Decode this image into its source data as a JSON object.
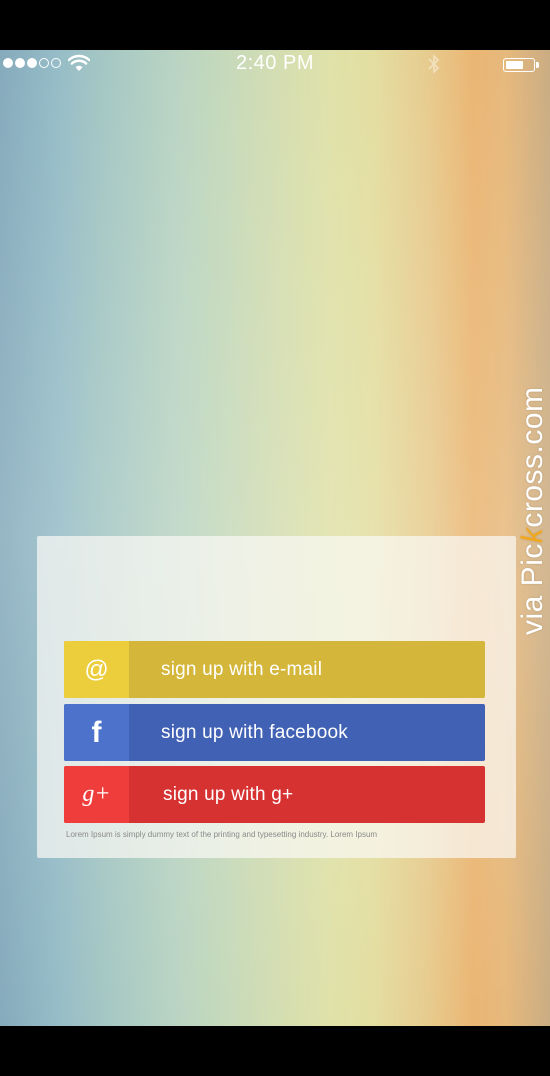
{
  "status_bar": {
    "time": "2:40 PM",
    "signal_total": 5,
    "signal_filled": 3,
    "battery_level": 0.65,
    "icons": [
      "signal-dots-icon",
      "wifi-icon",
      "bluetooth-icon",
      "battery-icon"
    ]
  },
  "signup": {
    "email": {
      "icon": "@",
      "label": "sign up with e-mail",
      "color": "#d4b63a",
      "icon_bg": "#eccd3b"
    },
    "facebook": {
      "icon": "f",
      "label": "sign up with facebook",
      "color": "#4061b4",
      "icon_bg": "#4c72cc"
    },
    "gplus": {
      "icon": "g+",
      "label": "sign up with g+",
      "color": "#d63232",
      "icon_bg": "#ee3d3a"
    },
    "disclaimer": "Lorem Ipsum is simply dummy text of the printing and typesetting industry. Lorem Ipsum"
  },
  "watermark": {
    "prefix": "via Pic",
    "highlight": "k",
    "suffix": "cross.com"
  }
}
